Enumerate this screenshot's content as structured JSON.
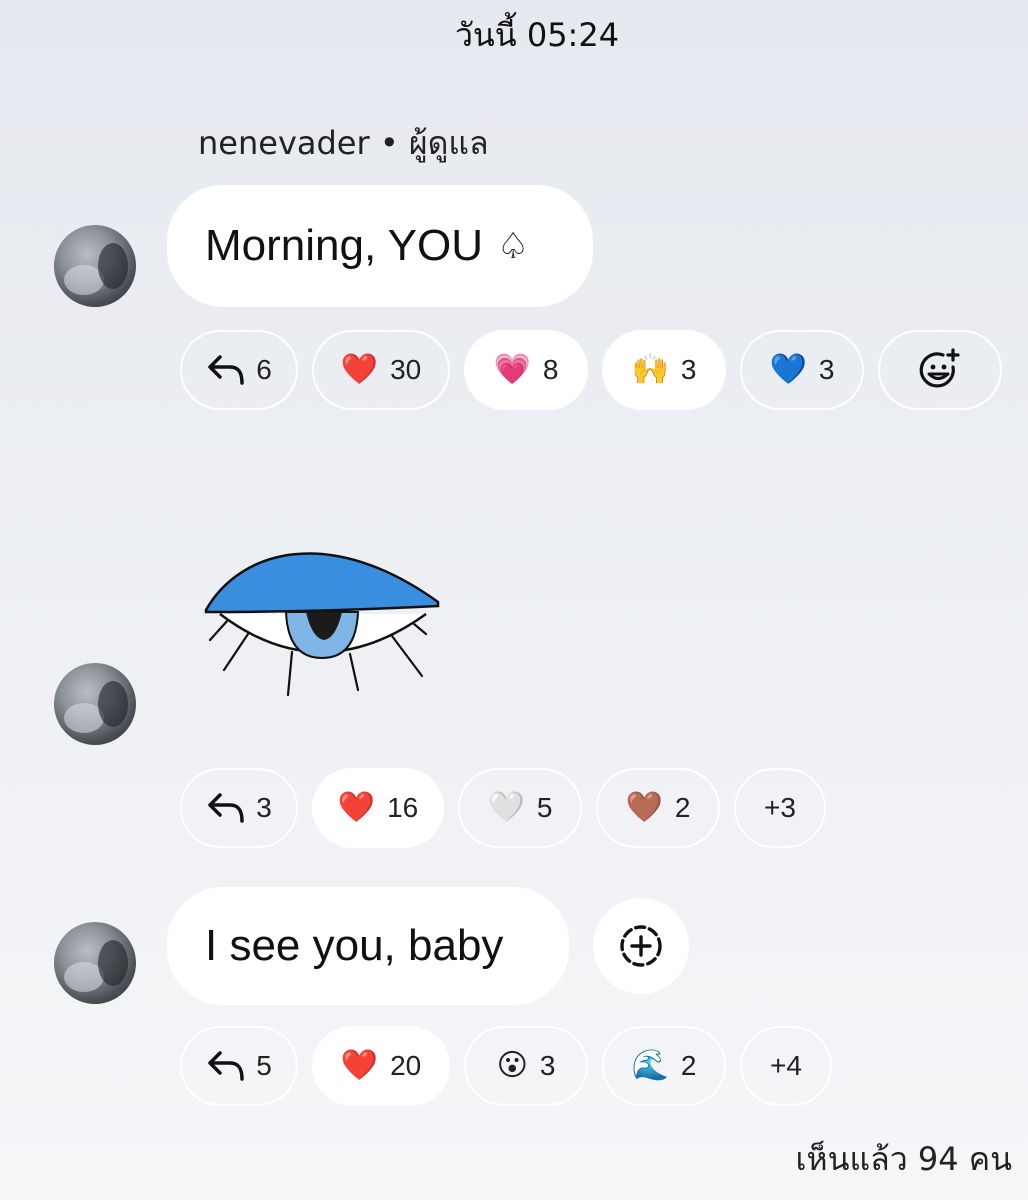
{
  "header": {
    "timestamp": "วันนี้ 05:24"
  },
  "sender": {
    "name": "nenevader",
    "separator": " • ",
    "role": "ผู้ดูแล"
  },
  "messages": [
    {
      "text": "Morning, YOU",
      "text_icon": "♤",
      "reactions": {
        "reply_count": "6",
        "items": [
          {
            "emoji": "❤️",
            "count": "30",
            "icon": "red-heart"
          },
          {
            "emoji": "💗",
            "count": "8",
            "icon": "growing-heart"
          },
          {
            "emoji": "🙌",
            "count": "3",
            "icon": "raising-hands"
          },
          {
            "emoji": "💙",
            "count": "3",
            "icon": "blue-heart"
          }
        ]
      }
    },
    {
      "sticker": "blue-eye-sticker",
      "reactions": {
        "reply_count": "3",
        "items": [
          {
            "emoji": "❤️",
            "count": "16",
            "icon": "red-heart"
          },
          {
            "emoji": "🤍",
            "count": "5",
            "icon": "white-heart"
          },
          {
            "emoji": "🤎",
            "count": "2",
            "icon": "brown-heart"
          }
        ],
        "more": "+3"
      }
    },
    {
      "text": "I see you, baby",
      "reactions": {
        "reply_count": "5",
        "items": [
          {
            "emoji": "❤️",
            "count": "20",
            "icon": "red-heart"
          },
          {
            "emoji": "😮",
            "count": "3",
            "icon": "surprised-face"
          },
          {
            "emoji": "🌊",
            "count": "2",
            "icon": "water-wave"
          }
        ],
        "more": "+4"
      }
    }
  ],
  "footer": {
    "seen": "เห็นแล้ว 94 คน"
  },
  "colors": {
    "background": "#e9ecf1",
    "bubble": "#ffffff",
    "sticker_blue": "#3a8ee0"
  }
}
